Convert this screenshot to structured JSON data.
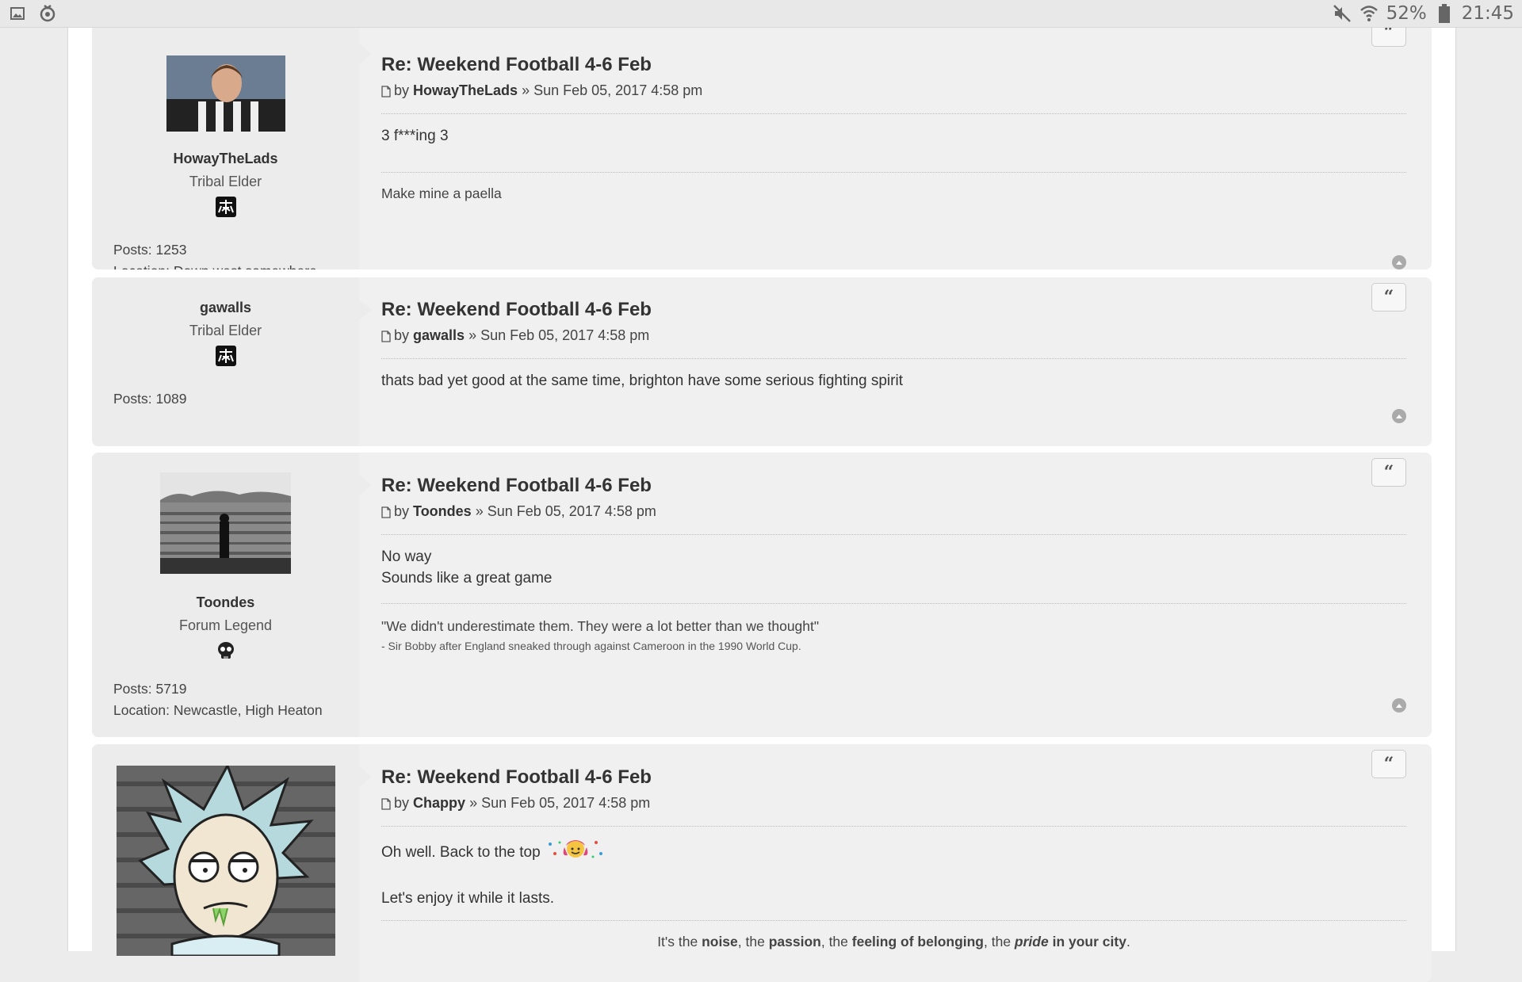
{
  "status_bar": {
    "battery": "52%",
    "time": "21:45"
  },
  "posts": [
    {
      "title": "Re: Weekend Football 4-6 Feb",
      "by": "by",
      "author": "HowayTheLads",
      "date": "» Sun Feb 05, 2017 4:58 pm",
      "content": [
        "3 f***ing 3"
      ],
      "signature": "Make mine a paella",
      "user": {
        "name": "HowayTheLads",
        "rank": "Tribal Elder",
        "posts_label": "Posts:",
        "posts": "1253",
        "location_label": "Location:",
        "location": "Down west somewhere."
      }
    },
    {
      "title": "Re: Weekend Football 4-6 Feb",
      "by": "by",
      "author": "gawalls",
      "date": "» Sun Feb 05, 2017 4:58 pm",
      "content": [
        "thats bad yet good at the same time, brighton have some serious fighting spirit"
      ],
      "user": {
        "name": "gawalls",
        "rank": "Tribal Elder",
        "posts_label": "Posts:",
        "posts": "1089"
      }
    },
    {
      "title": "Re: Weekend Football 4-6 Feb",
      "by": "by",
      "author": "Toondes",
      "date": "» Sun Feb 05, 2017 4:58 pm",
      "content": [
        "No way",
        "Sounds like a great game"
      ],
      "signature": "\"We didn't underestimate them. They were a lot better than we thought\"",
      "signature_small": "- Sir Bobby after England sneaked through against Cameroon in the 1990 World Cup.",
      "user": {
        "name": "Toondes",
        "rank": "Forum Legend",
        "posts_label": "Posts:",
        "posts": "5719",
        "location_label": "Location:",
        "location": "Newcastle, High Heaton"
      }
    },
    {
      "title": "Re: Weekend Football 4-6 Feb",
      "by": "by",
      "author": "Chappy",
      "date": "» Sun Feb 05, 2017 4:58 pm",
      "content": [
        "Oh well. Back to the top",
        "Let's enjoy it while it lasts."
      ],
      "signature_parts": {
        "p1": "It's the ",
        "b1": "noise",
        "p2": ", the ",
        "b2": "passion",
        "p3": ", the ",
        "b3": "feeling of belonging",
        "p4": ", the ",
        "bi": "pride",
        "b4": " in your city",
        "p5": "."
      }
    }
  ],
  "quote_label": "“",
  "icons": {
    "status_left": [
      "image-icon",
      "sync-icon"
    ],
    "status_right": [
      "mute-icon",
      "wifi-icon",
      "battery-icon"
    ],
    "post": [
      "file-icon",
      "quote-icon",
      "back-to-top-icon"
    ],
    "rank": [
      "tribal-elder-icon",
      "skull-icon"
    ]
  }
}
